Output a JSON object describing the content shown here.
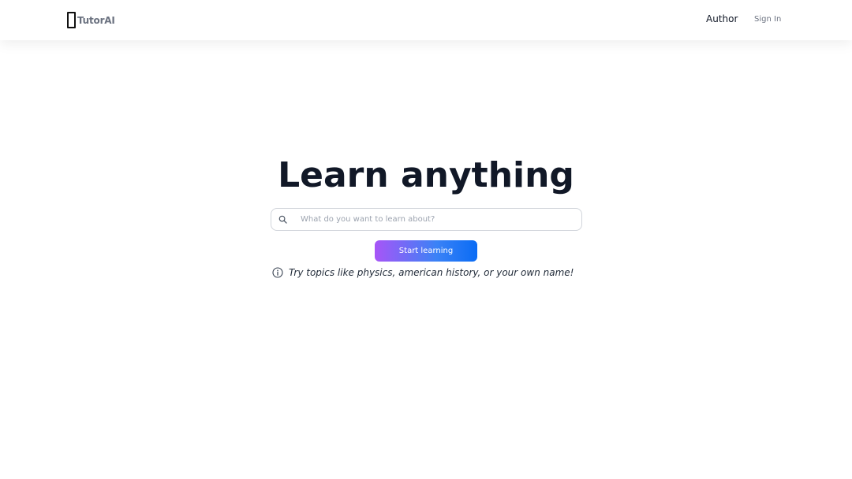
{
  "header": {
    "brand_name": "TutorAI",
    "brand_icon": "missing-glyph-box-icon",
    "nav": {
      "author_label": "Author",
      "signin_label": "Sign In"
    }
  },
  "hero": {
    "title": "Learn anything",
    "search": {
      "icon": "search-icon",
      "placeholder": "What do you want to learn about?",
      "value": ""
    },
    "start_button_label": "Start learning",
    "hint": {
      "icon": "info-icon",
      "text": "Try topics like physics, american history, or your own name!"
    }
  },
  "colors": {
    "title": "#111827",
    "muted": "#6b7280",
    "button_gradient_start": "#a855f7",
    "button_gradient_end": "#0a6cf5",
    "input_border": "#d1d5db"
  }
}
